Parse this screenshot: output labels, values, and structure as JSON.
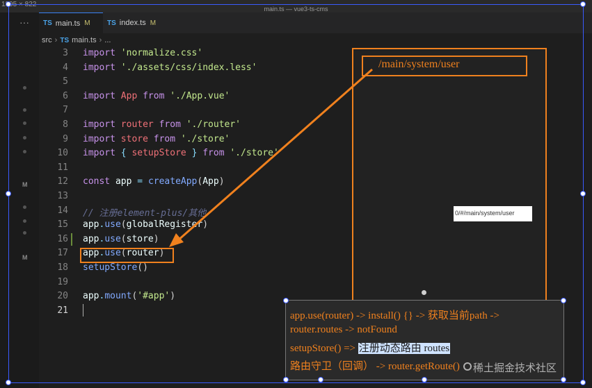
{
  "titlebar": {
    "left_text": "1395 × 822",
    "center_text": "main.ts — vue3-ts-cms"
  },
  "tabs": [
    {
      "label": "main.ts",
      "status": "M",
      "lang": "TS",
      "active": true
    },
    {
      "label": "index.ts",
      "status": "M",
      "lang": "TS",
      "active": false
    }
  ],
  "more_label": "···",
  "breadcrumb": {
    "folder": "src",
    "lang": "TS",
    "file": "main.ts",
    "tail": "..."
  },
  "activity_markers": [
    "M",
    "M"
  ],
  "code_lines": [
    {
      "n": "3",
      "tokens": [
        [
          "kw",
          "import"
        ],
        [
          "plain",
          " "
        ],
        [
          "str",
          "'normalize.css'"
        ]
      ]
    },
    {
      "n": "4",
      "tokens": [
        [
          "kw",
          "import"
        ],
        [
          "plain",
          " "
        ],
        [
          "str",
          "'./assets/css/index.less'"
        ]
      ]
    },
    {
      "n": "5",
      "tokens": []
    },
    {
      "n": "6",
      "tokens": [
        [
          "kw",
          "import"
        ],
        [
          "plain",
          " "
        ],
        [
          "id",
          "App"
        ],
        [
          "plain",
          " "
        ],
        [
          "kw",
          "from"
        ],
        [
          "plain",
          " "
        ],
        [
          "str",
          "'./App.vue'"
        ]
      ]
    },
    {
      "n": "7",
      "tokens": []
    },
    {
      "n": "8",
      "tokens": [
        [
          "kw",
          "import"
        ],
        [
          "plain",
          " "
        ],
        [
          "id",
          "router"
        ],
        [
          "plain",
          " "
        ],
        [
          "kw",
          "from"
        ],
        [
          "plain",
          " "
        ],
        [
          "str",
          "'./router'"
        ]
      ]
    },
    {
      "n": "9",
      "tokens": [
        [
          "kw",
          "import"
        ],
        [
          "plain",
          " "
        ],
        [
          "id",
          "store"
        ],
        [
          "plain",
          " "
        ],
        [
          "kw",
          "from"
        ],
        [
          "plain",
          " "
        ],
        [
          "str",
          "'./store'"
        ]
      ]
    },
    {
      "n": "10",
      "tokens": [
        [
          "kw",
          "import"
        ],
        [
          "plain",
          " "
        ],
        [
          "pu",
          "{"
        ],
        [
          "plain",
          " "
        ],
        [
          "id",
          "setupStore"
        ],
        [
          "plain",
          " "
        ],
        [
          "pu",
          "}"
        ],
        [
          "plain",
          " "
        ],
        [
          "kw",
          "from"
        ],
        [
          "plain",
          " "
        ],
        [
          "str",
          "'./store'"
        ]
      ]
    },
    {
      "n": "11",
      "tokens": []
    },
    {
      "n": "12",
      "tokens": [
        [
          "kw",
          "const"
        ],
        [
          "plain",
          " "
        ],
        [
          "var",
          "app"
        ],
        [
          "plain",
          " "
        ],
        [
          "pu",
          "="
        ],
        [
          "plain",
          " "
        ],
        [
          "fn",
          "createApp"
        ],
        [
          "plain",
          "("
        ],
        [
          "var",
          "App"
        ],
        [
          "plain",
          ")"
        ]
      ]
    },
    {
      "n": "13",
      "tokens": []
    },
    {
      "n": "14",
      "tokens": [
        [
          "cm",
          "// 注册element-plus/其他"
        ]
      ]
    },
    {
      "n": "15",
      "tokens": [
        [
          "var",
          "app"
        ],
        [
          "pu",
          "."
        ],
        [
          "fn",
          "use"
        ],
        [
          "plain",
          "("
        ],
        [
          "var",
          "globalRegister"
        ],
        [
          "plain",
          ")"
        ]
      ]
    },
    {
      "n": "16",
      "tokens": [
        [
          "var",
          "app"
        ],
        [
          "pu",
          "."
        ],
        [
          "fn",
          "use"
        ],
        [
          "plain",
          "("
        ],
        [
          "var",
          "store"
        ],
        [
          "plain",
          ")"
        ]
      ]
    },
    {
      "n": "17",
      "tokens": [
        [
          "var",
          "app"
        ],
        [
          "pu",
          "."
        ],
        [
          "fn",
          "use"
        ],
        [
          "plain",
          "("
        ],
        [
          "var",
          "router"
        ],
        [
          "plain",
          ")"
        ]
      ]
    },
    {
      "n": "18",
      "tokens": [
        [
          "fn",
          "setupStore"
        ],
        [
          "plain",
          "()"
        ]
      ]
    },
    {
      "n": "19",
      "tokens": []
    },
    {
      "n": "20",
      "tokens": [
        [
          "var",
          "app"
        ],
        [
          "pu",
          "."
        ],
        [
          "fn",
          "mount"
        ],
        [
          "plain",
          "("
        ],
        [
          "str",
          "'#app'"
        ],
        [
          "plain",
          ")"
        ]
      ]
    },
    {
      "n": "21",
      "tokens": []
    }
  ],
  "current_line": "21",
  "preview": {
    "url": "/main/system/user",
    "hint": "0/#/main/system/user"
  },
  "note": {
    "line1": "app.use(router) -> install() {} -> 获取当前path ->",
    "line2": "router.routes -> notFound",
    "line3_prefix": "setupStore() => ",
    "line3_highlight": "注册动态路由 routes",
    "line4": "路由守卫（回调）  -> router.getRoute()"
  },
  "watermark": "稀土掘金技术社区",
  "colors": {
    "annotation": "#f0811e",
    "keyword": "#c792ea",
    "string": "#c3e88d",
    "function": "#82aaff"
  }
}
